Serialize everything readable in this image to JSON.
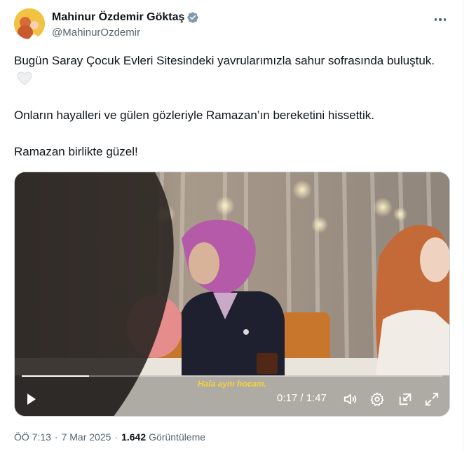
{
  "author": {
    "display_name": "Mahinur Özdemir Göktaş",
    "handle": "@MahinurOzdemir",
    "avatar_icon": "profile-photo",
    "verified_icon": "verified-badge-icon"
  },
  "tweet": {
    "line1": "Bugün Saray Çocuk Evleri Sitesindeki yavrularımızla sahur sofrasında buluştuk.",
    "emoji_icon": "white-heart-icon",
    "line2": "Onların hayalleri ve gülen gözleriyle Ramazan’ın bereketini hissettik.",
    "line3": "Ramazan birlikte güzel!"
  },
  "video": {
    "subtitle": "Hala aynı hocam.",
    "current_time": "0:17",
    "total_time": "1:47",
    "time_display": "0:17 / 1:47",
    "progress_fraction": 0.16,
    "icons": [
      "play-icon",
      "volume-icon",
      "settings-icon",
      "popout-icon",
      "fullscreen-icon"
    ]
  },
  "meta": {
    "time": "ÖÖ 7:13",
    "separator": "·",
    "date": "7 Mar 2025",
    "views_count": "1.642",
    "views_label": "Görüntüleme"
  },
  "colors": {
    "text_primary": "#0f1419",
    "text_secondary": "#536471",
    "verified": "#829aab",
    "subtitle": "#f5d23b"
  }
}
